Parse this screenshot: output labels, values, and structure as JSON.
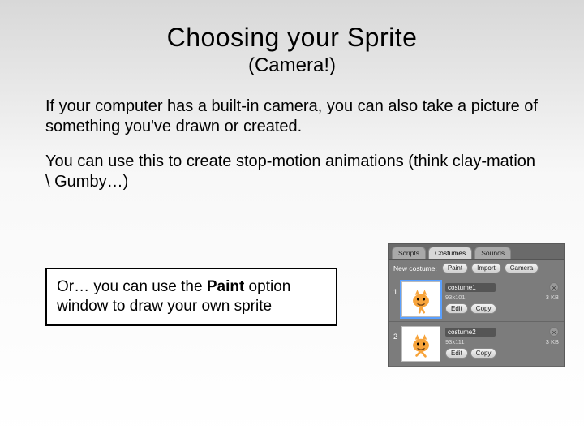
{
  "title": "Choosing your Sprite",
  "subtitle": "(Camera!)",
  "para1": "If your computer has a built-in camera, you can also take a picture of something you've drawn or created.",
  "para2": "You can use this to create stop-motion animations (think clay-mation \\ Gumby…)",
  "callout_pre": "Or…  you can use the ",
  "callout_bold": "Paint",
  "callout_post": " option window to draw your own sprite",
  "panel": {
    "tabs": {
      "scripts": "Scripts",
      "costumes": "Costumes",
      "sounds": "Sounds"
    },
    "new_label": "New costume:",
    "paint": "Paint",
    "import": "Import",
    "camera": "Camera",
    "items": [
      {
        "idx": "1",
        "name": "costume1",
        "dims": "93x101",
        "size": "3 KB",
        "edit": "Edit",
        "copy": "Copy"
      },
      {
        "idx": "2",
        "name": "costume2",
        "dims": "93x111",
        "size": "3 KB",
        "edit": "Edit",
        "copy": "Copy"
      }
    ],
    "close": "×"
  }
}
